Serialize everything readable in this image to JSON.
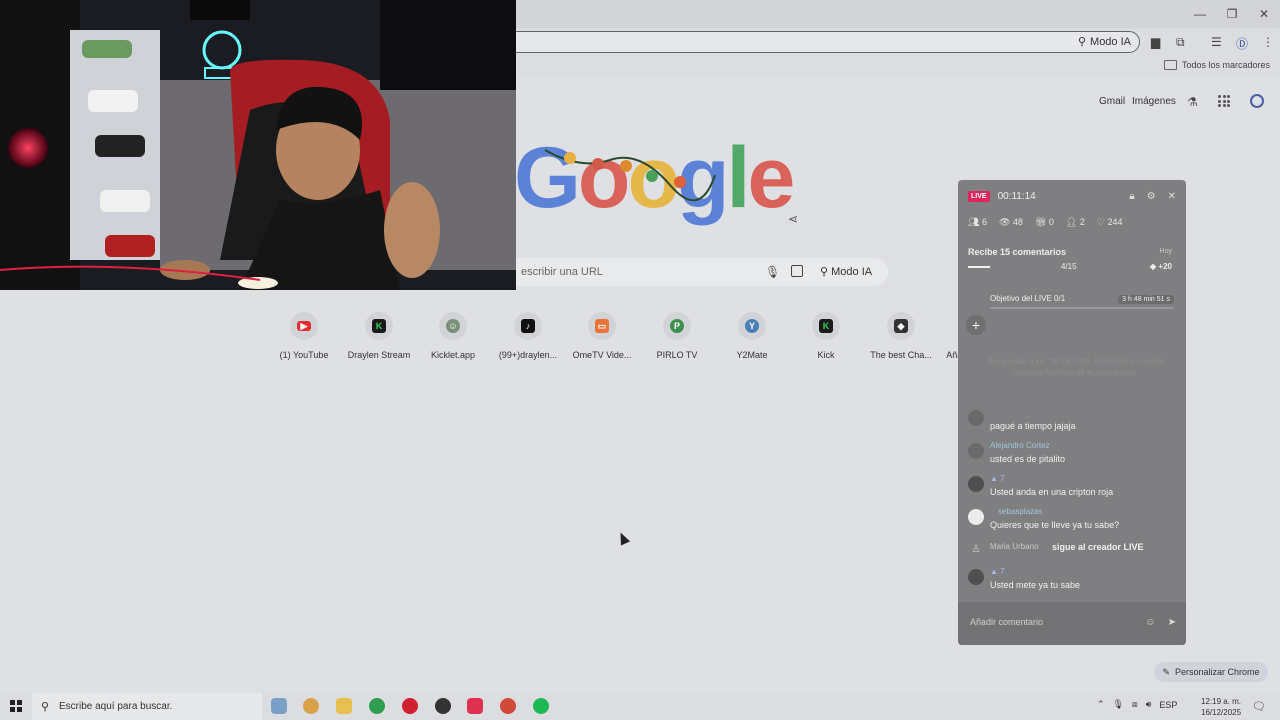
{
  "omnibox": {
    "modo_label": "Modo IA"
  },
  "bookmarks": {
    "all_label": "Todos los marcadores"
  },
  "header": {
    "gmail": "Gmail",
    "images": "Imágenes"
  },
  "search": {
    "placeholder": "escribir una URL",
    "modo_label": "Modo IA"
  },
  "shortcuts": [
    {
      "label": "(1) YouTube"
    },
    {
      "label": "Draylen Stream"
    },
    {
      "label": "Kicklet.app"
    },
    {
      "label": "(99+)draylen..."
    },
    {
      "label": "OmeTV Vide..."
    },
    {
      "label": "PIRLO TV",
      "letter": "P"
    },
    {
      "label": "Y2Mate",
      "letter": "Y"
    },
    {
      "label": "Kick"
    },
    {
      "label": "The best Cha..."
    },
    {
      "label": "Añadir acces..."
    }
  ],
  "customize": {
    "label": "Personalizar Chrome"
  },
  "live": {
    "badge": "LIVE",
    "time": "00:11:14",
    "stats": {
      "viewers": "6",
      "views": "48",
      "gifts": "0",
      "follows": "2",
      "likes": "244"
    },
    "goal": {
      "title": "Recibe 15 comentarios",
      "day": "Hoy",
      "progress": "4/15",
      "progress_value": 0.27,
      "bonus": "+20"
    },
    "objective": {
      "label": "Objetivo del LIVE 0/1",
      "time_left": "3 h 48 min 51 s"
    },
    "ghost_text": "Bienvenido a los TikTok LIVE. Diviértete y cumple nuestras Normas de la comunidad.",
    "comments": [
      {
        "name": "",
        "text": "pagué a tiempo jajaja"
      },
      {
        "name": "Alejandro Cortez",
        "text": "usted es de pitalito"
      },
      {
        "name": "▲ 7",
        "text": "Usted anda en una cripton roja"
      },
      {
        "name": "sebasplazas",
        "text": "Quieres que te lleve ya tu sabe?"
      },
      {
        "name": "Maria Urbano",
        "text": "sigue al creador LIVE"
      },
      {
        "name": "▲ 7",
        "text": "Usted mete ya tu sabe"
      }
    ],
    "input_placeholder": "Añadir comentario"
  },
  "taskbar": {
    "search_text": "Escribe aquí para buscar.",
    "lang": "ESP",
    "time": "12:19 a. m.",
    "date": "16/12/2025"
  },
  "colors": {
    "live_red": "#e0245e",
    "youtube": "#e03030",
    "kick": "#2ed04f"
  }
}
